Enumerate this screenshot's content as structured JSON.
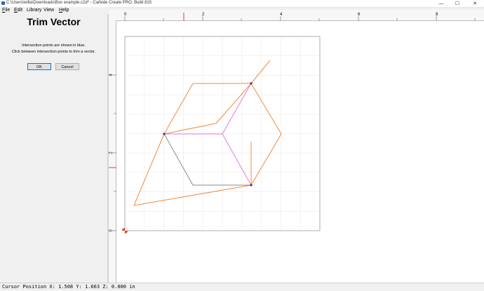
{
  "window": {
    "title": "C:\\Users\\willa\\Downloads\\Box example.c2d* - Carbide Create PRO, Build 815",
    "minimize_glyph": "—",
    "maximize_glyph": "☐",
    "close_glyph": "✕"
  },
  "menu": {
    "file": "ile",
    "edit": "dit",
    "library": "Library",
    "view": "View",
    "help": "elp",
    "file_mnemonic": "F",
    "edit_mnemonic": "E",
    "help_mnemonic": "H"
  },
  "panel": {
    "title": "Trim Vector",
    "line1": "Intersection points are shown in blue.",
    "line2": "Click between intersection points to trim a vector.",
    "ok_label": "OK",
    "cancel_label": "Cancel"
  },
  "ruler": {
    "top_ticks": [
      "0",
      "2",
      "4",
      "6",
      "8"
    ],
    "left_ticks": [
      "4",
      "2",
      "0"
    ]
  },
  "colors": {
    "vector_orange": "#f08a3c",
    "selected_magenta": "#e37ae8",
    "trimmed_gray": "#8a8a8a",
    "intersection_point": "#5a2d6e",
    "cursor_marker": "#e8401c"
  },
  "status": {
    "cursor_position": "Cursor Position X: 1.508 Y: 1.663 Z: 0.000 in"
  }
}
